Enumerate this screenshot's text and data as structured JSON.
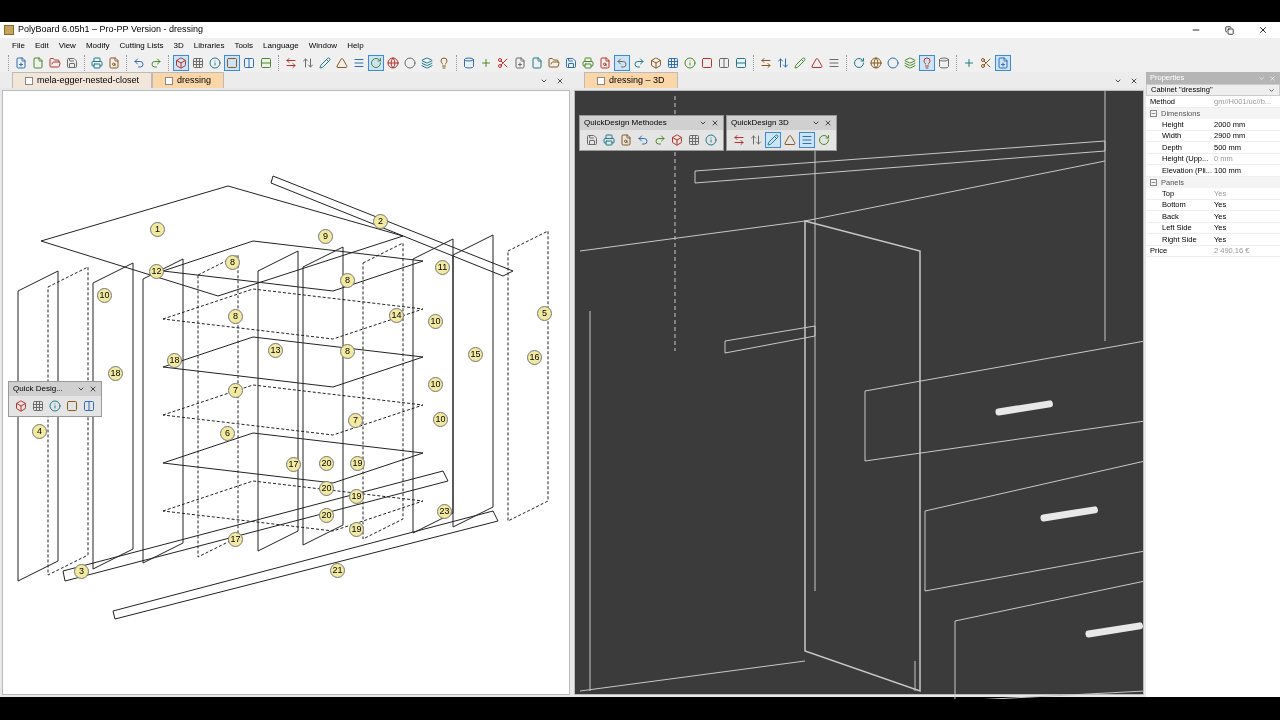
{
  "window": {
    "title": "PolyBoard 6.05h1 – Pro-PP Version - dressing"
  },
  "menu": [
    "File",
    "Edit",
    "View",
    "Modify",
    "Cutting Lists",
    "3D",
    "Libraries",
    "Tools",
    "Language",
    "Window",
    "Help"
  ],
  "toolbar": [
    [
      {
        "pressed": false
      },
      {
        "pressed": false
      },
      {
        "pressed": false
      },
      {
        "pressed": false
      }
    ],
    [
      {
        "pressed": false
      },
      {
        "pressed": false
      }
    ],
    [
      {
        "pressed": false
      },
      {
        "pressed": false
      }
    ],
    [
      {
        "pressed": true
      },
      {
        "pressed": false
      },
      {
        "pressed": false
      },
      {
        "pressed": true
      },
      {
        "pressed": false
      },
      {
        "pressed": false
      }
    ],
    [
      {
        "pressed": false
      },
      {
        "pressed": false
      },
      {
        "pressed": false
      },
      {
        "pressed": false
      },
      {
        "pressed": false
      },
      {
        "pressed": true
      },
      {
        "pressed": false
      },
      {
        "pressed": false
      },
      {
        "pressed": false
      },
      {
        "pressed": false
      }
    ],
    [
      {
        "pressed": false
      },
      {
        "pressed": false
      },
      {
        "pressed": false
      },
      {
        "pressed": false
      },
      {
        "pressed": false
      },
      {
        "pressed": false
      },
      {
        "pressed": false
      },
      {
        "pressed": false
      },
      {
        "pressed": false
      },
      {
        "pressed": true
      },
      {
        "pressed": false
      },
      {
        "pressed": false
      },
      {
        "pressed": false
      },
      {
        "pressed": false
      },
      {
        "pressed": false
      },
      {
        "pressed": false
      },
      {
        "pressed": false
      }
    ],
    [
      {
        "pressed": false
      },
      {
        "pressed": false
      },
      {
        "pressed": false
      },
      {
        "pressed": false
      },
      {
        "pressed": false
      }
    ],
    [
      {
        "pressed": false
      },
      {
        "pressed": false
      },
      {
        "pressed": false
      },
      {
        "pressed": false
      },
      {
        "pressed": true
      },
      {
        "pressed": false
      }
    ],
    [
      {
        "pressed": false
      },
      {
        "pressed": false
      },
      {
        "pressed": true
      }
    ]
  ],
  "left_pane": {
    "tabs": [
      {
        "label": "mela-egger-nested-closet",
        "selected": false
      },
      {
        "label": "dressing",
        "selected": true
      }
    ],
    "markers": [
      "1",
      "2",
      "9",
      "8",
      "12",
      "10",
      "11",
      "8",
      "8",
      "5",
      "18",
      "14",
      "10",
      "13",
      "8",
      "15",
      "16",
      "18",
      "7",
      "10",
      "4",
      "6",
      "7",
      "10",
      "17",
      "20",
      "19",
      "20",
      "19",
      "20",
      "19",
      "23",
      "17",
      "3",
      "21"
    ],
    "quick_toolbar": {
      "title": "Quick Desig...",
      "buttons": [
        {
          "pressed": false
        },
        {
          "pressed": false
        },
        {
          "pressed": false
        },
        {
          "pressed": false
        },
        {
          "pressed": false
        }
      ]
    }
  },
  "right_pane": {
    "tabs": [
      {
        "label": "dressing – 3D",
        "selected": true
      }
    ],
    "toolbars": [
      {
        "title": "QuickDesign Methodes",
        "buttons": [
          {
            "pressed": false
          },
          {
            "pressed": false
          },
          {
            "pressed": false
          },
          {
            "pressed": false
          },
          {
            "pressed": false
          },
          {
            "pressed": false
          },
          {
            "pressed": false
          },
          {
            "pressed": false
          }
        ]
      },
      {
        "title": "QuickDesign 3D",
        "buttons": [
          {
            "pressed": false
          },
          {
            "pressed": false
          },
          {
            "pressed": true
          },
          {
            "pressed": false
          },
          {
            "pressed": true
          },
          {
            "pressed": false
          }
        ]
      }
    ]
  },
  "properties": {
    "title": "Properties",
    "selector": "Cabinet \"dressing\"",
    "rows": [
      {
        "kind": "row",
        "label": "Method",
        "value": "gm//H001/uc//b...",
        "disabled": true
      },
      {
        "kind": "group",
        "label": "Dimensions",
        "expanded": true,
        "children": [
          {
            "label": "Height",
            "value": "2000 mm",
            "disabled": false
          },
          {
            "label": "Width",
            "value": "2900 mm",
            "disabled": false
          },
          {
            "label": "Depth",
            "value": "500 mm",
            "disabled": false
          },
          {
            "label": "Height (Upp...",
            "value": "0 mm",
            "disabled": true
          },
          {
            "label": "Elevation (Pli...",
            "value": "100 mm",
            "disabled": false
          }
        ]
      },
      {
        "kind": "group",
        "label": "Panels",
        "expanded": true,
        "children": [
          {
            "label": "Top",
            "value": "Yes",
            "disabled": true
          },
          {
            "label": "Bottom",
            "value": "Yes",
            "disabled": false
          },
          {
            "label": "Back",
            "value": "Yes",
            "disabled": false
          },
          {
            "label": "Left Side",
            "value": "Yes",
            "disabled": false
          },
          {
            "label": "Right Side",
            "value": "Yes",
            "disabled": false
          }
        ]
      },
      {
        "kind": "row",
        "label": "Price",
        "value": "2 490,16 €",
        "disabled": true
      }
    ]
  }
}
